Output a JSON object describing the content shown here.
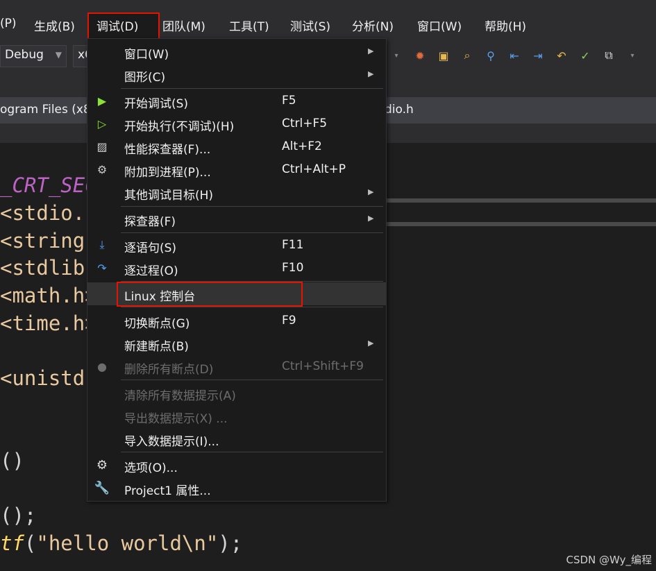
{
  "menubar": {
    "items": [
      "(P)",
      "生成(B)",
      "调试(D)",
      "团队(M)",
      "工具(T)",
      "测试(S)",
      "分析(N)",
      "窗口(W)",
      "帮助(H)"
    ]
  },
  "toolbar": {
    "config": "Debug",
    "platform": "x6"
  },
  "tabs": {
    "path_left": "ogram Files (x8",
    "path_right": "dio.h"
  },
  "code": {
    "line1": "_CRT_SEC",
    "line2": "<stdio.h",
    "line3": "<string.",
    "line4": "<stdlib.",
    "line5": "<math.h>",
    "line6": "<time.h>",
    "line7": "<unistd.",
    "line8": "()",
    "line9": "();",
    "line10_fn": "tf",
    "line10_open": "(",
    "line10_str": "\"hello world\\n\"",
    "line10_close": ");"
  },
  "menu": {
    "window": "窗口(W)",
    "graphics": "图形(C)",
    "start_debug": "开始调试(S)",
    "start_debug_sc": "F5",
    "start_nodebug": "开始执行(不调试)(H)",
    "start_nodebug_sc": "Ctrl+F5",
    "profiler": "性能探查器(F)...",
    "profiler_sc": "Alt+F2",
    "attach": "附加到进程(P)...",
    "attach_sc": "Ctrl+Alt+P",
    "other_targets": "其他调试目标(H)",
    "explorer": "探查器(F)",
    "step_into": "逐语句(S)",
    "step_into_sc": "F11",
    "step_over": "逐过程(O)",
    "step_over_sc": "F10",
    "linux_console": "Linux 控制台",
    "toggle_bp": "切换断点(G)",
    "toggle_bp_sc": "F9",
    "new_bp": "新建断点(B)",
    "delete_bp": "删除所有断点(D)",
    "delete_bp_sc": "Ctrl+Shift+F9",
    "clear_datatips": "清除所有数据提示(A)",
    "export_datatips": "导出数据提示(X) ...",
    "import_datatips": "导入数据提示(I)...",
    "options": "选项(O)...",
    "properties": "Project1 属性..."
  },
  "watermark": "CSDN @Wy_编程"
}
